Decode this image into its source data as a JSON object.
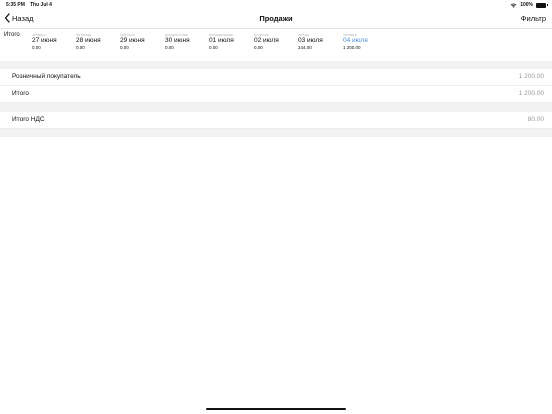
{
  "status": {
    "time": "5:35 PM",
    "date": "Thu Jul 4",
    "battery": "100%",
    "icons": [
      "wifi-icon",
      "battery-icon"
    ]
  },
  "nav": {
    "back_label": "Назад",
    "title": "Продажи",
    "filter_label": "Фильтр"
  },
  "strip": {
    "label": "Итого",
    "days": [
      {
        "weekday": "четверг",
        "date": "27 июня",
        "sum": "0.00"
      },
      {
        "weekday": "пятница",
        "date": "28 июня",
        "sum": "0.00"
      },
      {
        "weekday": "суббота",
        "date": "29 июня",
        "sum": "0.00"
      },
      {
        "weekday": "воскресенье",
        "date": "30 июня",
        "sum": "0.00"
      },
      {
        "weekday": "понедельник",
        "date": "01 июля",
        "sum": "0.00"
      },
      {
        "weekday": "вторник",
        "date": "02 июля",
        "sum": "0.00"
      },
      {
        "weekday": "среда",
        "date": "03 июля",
        "sum": "244.00"
      },
      {
        "weekday": "четверг",
        "date": "04 июля",
        "sum": "1 200.00"
      }
    ],
    "active_index": 7,
    "active_color": "#4a90d9"
  },
  "summary": {
    "rows": [
      {
        "label": "Розничный покупатель",
        "value": "1 200.00"
      },
      {
        "label": "Итого",
        "value": "1 200.00"
      }
    ],
    "vat": {
      "label": "Итого НДС",
      "value": "80.00"
    }
  }
}
